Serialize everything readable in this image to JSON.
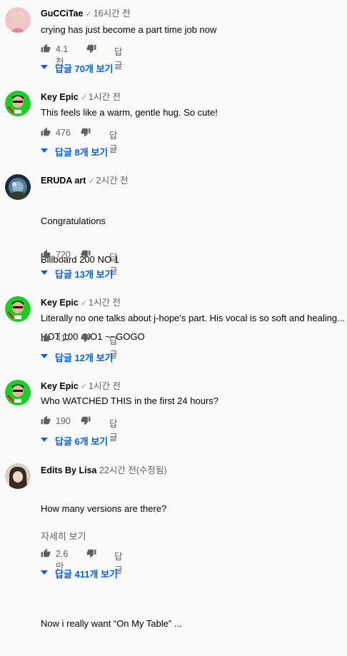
{
  "comments": [
    {
      "author": "GuCCiTae",
      "time": "16시간 전",
      "lines": [
        "crying has just become a part time job now"
      ],
      "likes": "4.1천",
      "reply_label": "답글",
      "view_replies": "답글 70개 보기"
    },
    {
      "author": "Key Epic",
      "time": "1시간 전",
      "lines": [
        "This feels like a warm, gentle hug. So cute!"
      ],
      "likes": "476",
      "reply_label": "답글",
      "view_replies": "답글 8개 보기"
    },
    {
      "author": "ERUDA art",
      "time": "2시간 전",
      "lines": [
        "Congratulations",
        "Billboard 200 NO 1",
        "",
        "HOT 100  NO1 ~~GOGO"
      ],
      "likes": "720",
      "reply_label": "답글",
      "view_replies": "답글 13개 보기"
    },
    {
      "author": "Key Epic",
      "time": "1시간 전",
      "lines": [
        "Literally no one talks about j-hope's part. His vocal is so soft and healing..."
      ],
      "likes": "417",
      "reply_label": "답글",
      "view_replies": "답글 12개 보기"
    },
    {
      "author": "Key Epic",
      "time": "1시간 전",
      "lines": [
        "Who WATCHED THIS in the first 24 hours?"
      ],
      "likes": "190",
      "reply_label": "답글",
      "view_replies": "답글 6개 보기"
    },
    {
      "author": "Edits By Lisa",
      "time": "22시간 전(수정됨)",
      "lines": [
        "How many versions are there?",
        "",
        "",
        "Now i really want “On My Table” ..."
      ],
      "read_more": "자세히 보기",
      "likes": "2.6만",
      "reply_label": "답글",
      "view_replies": "답글 411개 보기"
    }
  ],
  "colors": {
    "link_blue": "#065fd4",
    "meta_gray": "#606060",
    "icon_gray": "#606060",
    "background": "#f9f9f9"
  },
  "icons": {
    "verified": "check-icon",
    "like": "thumbs-up-icon",
    "dislike": "thumbs-down-icon",
    "expand": "caret-down-icon"
  }
}
